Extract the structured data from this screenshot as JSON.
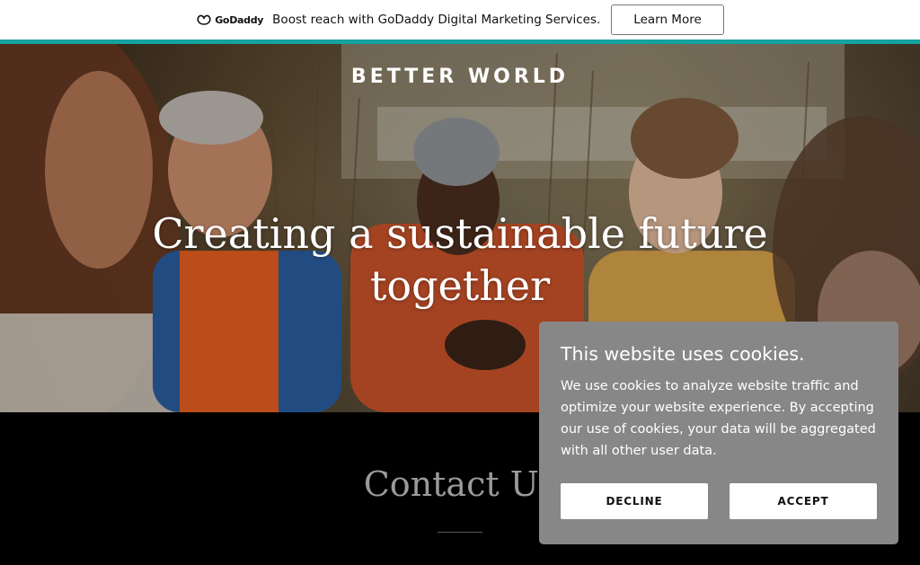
{
  "promo": {
    "logo_text": "GoDaddy",
    "message": "Boost reach with GoDaddy Digital Marketing Services.",
    "button_label": "Learn More"
  },
  "hero": {
    "brand": "BETTER WORLD",
    "headline_line1": "Creating a sustainable future",
    "headline_line2": "together"
  },
  "contact": {
    "title": "Contact Us"
  },
  "cookie": {
    "title": "This website uses cookies.",
    "body": "We use cookies to analyze website traffic and optimize your website experience. By accepting our use of cookies, your data will be aggregated with all other user data.",
    "decline_label": "DECLINE",
    "accept_label": "ACCEPT"
  },
  "colors": {
    "accent_rule": "#14a3a0",
    "cookie_panel": "#878787",
    "page_background": "#000000"
  }
}
